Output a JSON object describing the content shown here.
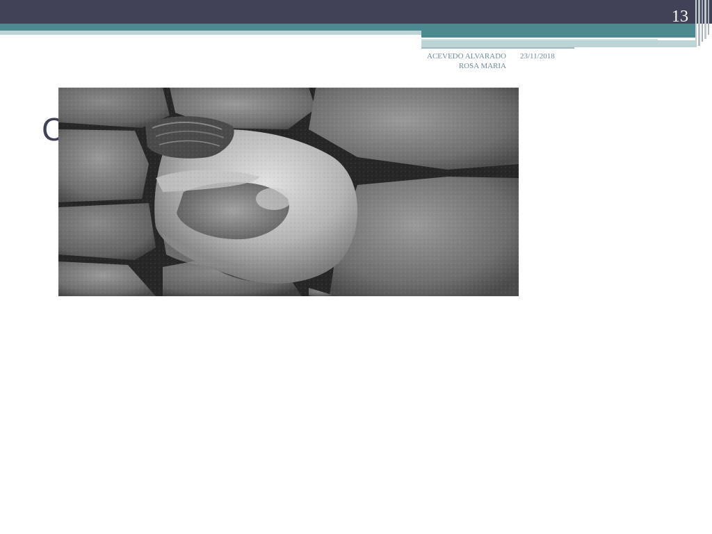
{
  "slide": {
    "number": "13",
    "footer_author": "ACEVEDO ALVARADO ROSA MARIA",
    "footer_date": "23/11/2018",
    "title_fragment": "C"
  },
  "image": {
    "description_icon": "photo-woman-curled-among-stones"
  },
  "colors": {
    "header": "#404258",
    "accent_teal": "#4d8a8f",
    "accent_light": "#bcd4d6",
    "footer_text": "#6f8b94"
  }
}
